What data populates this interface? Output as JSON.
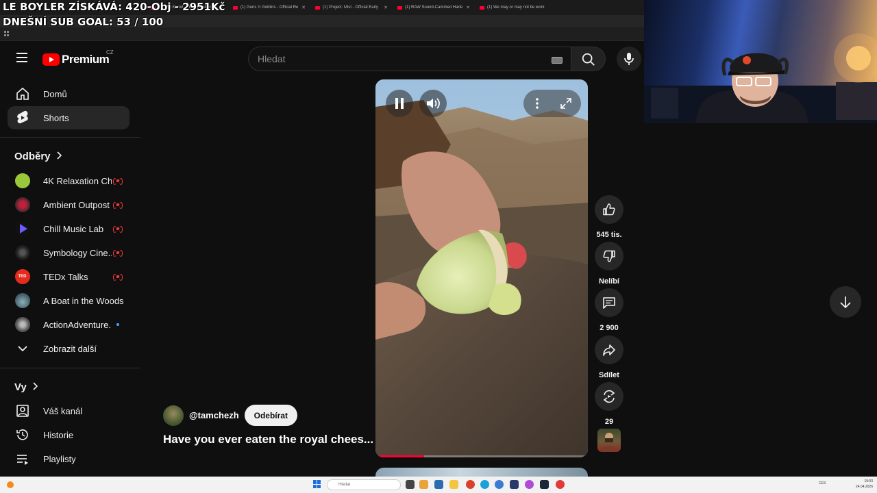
{
  "overlay": {
    "line1": "LE BOYLER ZÍSKÁVÁ: 420-Obj - 2951Kč",
    "line2": "DNEŠNÍ SUB GOAL: 53 / 100"
  },
  "browser": {
    "tabs": [
      {
        "title": "(1) The Blood of Dawnwalker -"
      },
      {
        "title": "(1) Guns 'n Goblins - Official Re"
      },
      {
        "title": "(1) Project: Mist - Official Early"
      },
      {
        "title": "(1) RAW Sound-Cammed Harle"
      },
      {
        "title": "(1) We may or may not be work"
      }
    ],
    "tab_close": "✕"
  },
  "header": {
    "logo_text": "Premium",
    "country_code": "CZ",
    "search_placeholder": "Hledat"
  },
  "sidebar": {
    "main": [
      {
        "label": "Domů"
      },
      {
        "label": "Shorts"
      }
    ],
    "subscriptions_title": "Odběry",
    "subscriptions": [
      {
        "label": "4K Relaxation Ch...",
        "color": "#9bc83a",
        "status": "live"
      },
      {
        "label": "Ambient Outpost",
        "color": "#c0203a",
        "status": "live"
      },
      {
        "label": "Chill Music Lab",
        "color": "#4a3fd0",
        "status": "live"
      },
      {
        "label": "Symbology Cine...",
        "color": "#2a2a2a",
        "status": "live"
      },
      {
        "label": "TEDx Talks",
        "color": "#e62b1e",
        "status": "live"
      },
      {
        "label": "A Boat in the Woods",
        "color": "#5d7d8a",
        "status": "none"
      },
      {
        "label": "ActionAdventure...",
        "color": "#6a6a6a",
        "status": "new"
      }
    ],
    "show_more": "Zobrazit další",
    "you_title": "Vy",
    "you": [
      {
        "label": "Váš kanál"
      },
      {
        "label": "Historie"
      },
      {
        "label": "Playlisty"
      }
    ]
  },
  "short": {
    "channel": "@tamchezh",
    "subscribe_label": "Odebírat",
    "title": "Have you ever eaten the royal chees...",
    "progress": 0.23,
    "actions": {
      "like_count": "545 tis.",
      "dislike_label": "Nelíbí",
      "comment_count": "2 900",
      "share_label": "Sdílet",
      "remix_count": "29"
    }
  },
  "taskbar": {
    "search_placeholder": "Hledat",
    "time": "19:03",
    "date": "24.04.2026",
    "lang": "CES"
  },
  "colors": {
    "background": "#0f0f0f",
    "accent": "#ff0033",
    "live": "#ff3b3b",
    "new_dot": "#3ea6ff"
  }
}
